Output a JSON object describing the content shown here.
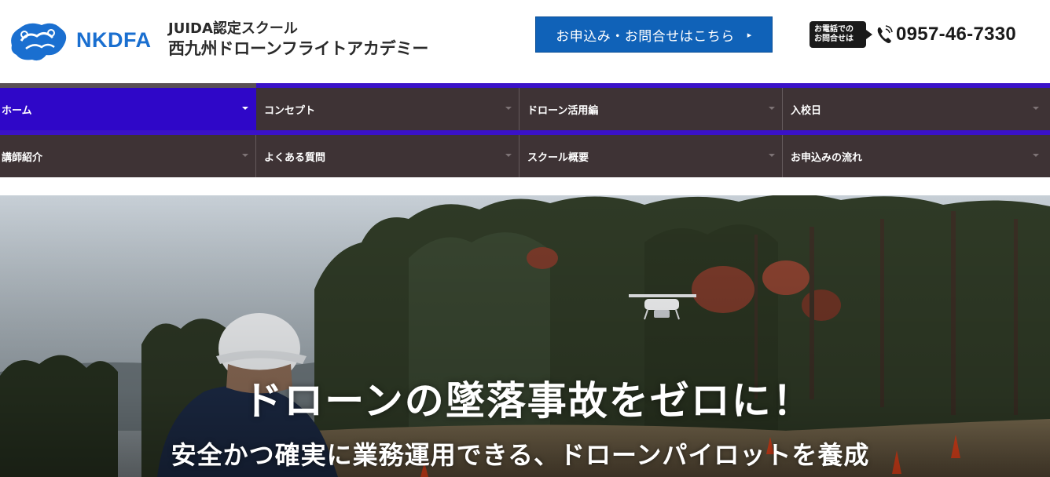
{
  "header": {
    "logo_text": "NKDFA",
    "school_sub": "JUIDA認定スクール",
    "school_name": "西九州ドローンフライトアカデミー",
    "cta_label": "お申込み・お問合せはこちら",
    "cta_arrow": "▸",
    "phone_badge_line1": "お電話での",
    "phone_badge_line2": "お問合せは",
    "phone_number": "0957-46-7330"
  },
  "nav": {
    "row1": [
      {
        "label": "ホーム",
        "active": true
      },
      {
        "label": "コンセプト",
        "active": false
      },
      {
        "label": "ドローン活用編",
        "active": false
      },
      {
        "label": "入校日",
        "active": false
      }
    ],
    "row2": [
      {
        "label": "講師紹介",
        "active": false
      },
      {
        "label": "よくある質問",
        "active": false
      },
      {
        "label": "スクール概要",
        "active": false
      },
      {
        "label": "お申込みの流れ",
        "active": false
      }
    ]
  },
  "hero": {
    "title": "ドローンの墜落事故をゼロに！",
    "subtitle": "安全かつ確実に業務運用できる、ドローンパイロットを養成"
  },
  "colors": {
    "brand_blue": "#1062b8",
    "nav_bg": "#3e3335",
    "nav_active": "#2f07c8",
    "logo_blue": "#1a6fd0"
  },
  "icons": {
    "phone": "phone-icon",
    "caret": "caret-down-icon",
    "cta_arrow": "arrow-right-icon"
  }
}
